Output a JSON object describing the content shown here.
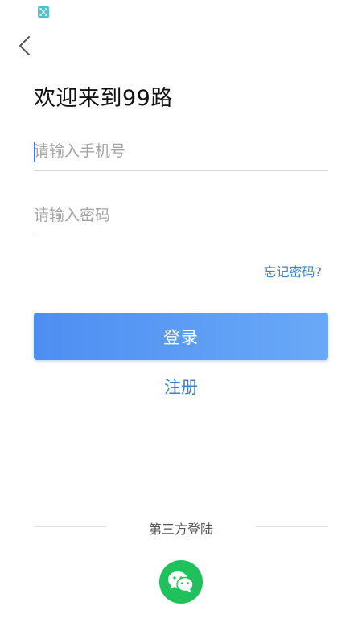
{
  "welcome": {
    "title": "欢迎来到99路"
  },
  "form": {
    "phone_placeholder": "请输入手机号",
    "phone_value": "",
    "password_placeholder": "请输入密码",
    "password_value": ""
  },
  "links": {
    "forgot_password": "忘记密码?",
    "register": "注册"
  },
  "buttons": {
    "login": "登录"
  },
  "third_party": {
    "label": "第三方登陆",
    "providers": [
      "wechat-icon"
    ]
  },
  "icons": {
    "back": "chevron-left-icon",
    "status": "scan-icon"
  },
  "colors": {
    "accent": "#3b82c8",
    "login_gradient_start": "#4d8ef2",
    "login_gradient_end": "#6aa9f7",
    "wechat": "#1fc15d"
  }
}
